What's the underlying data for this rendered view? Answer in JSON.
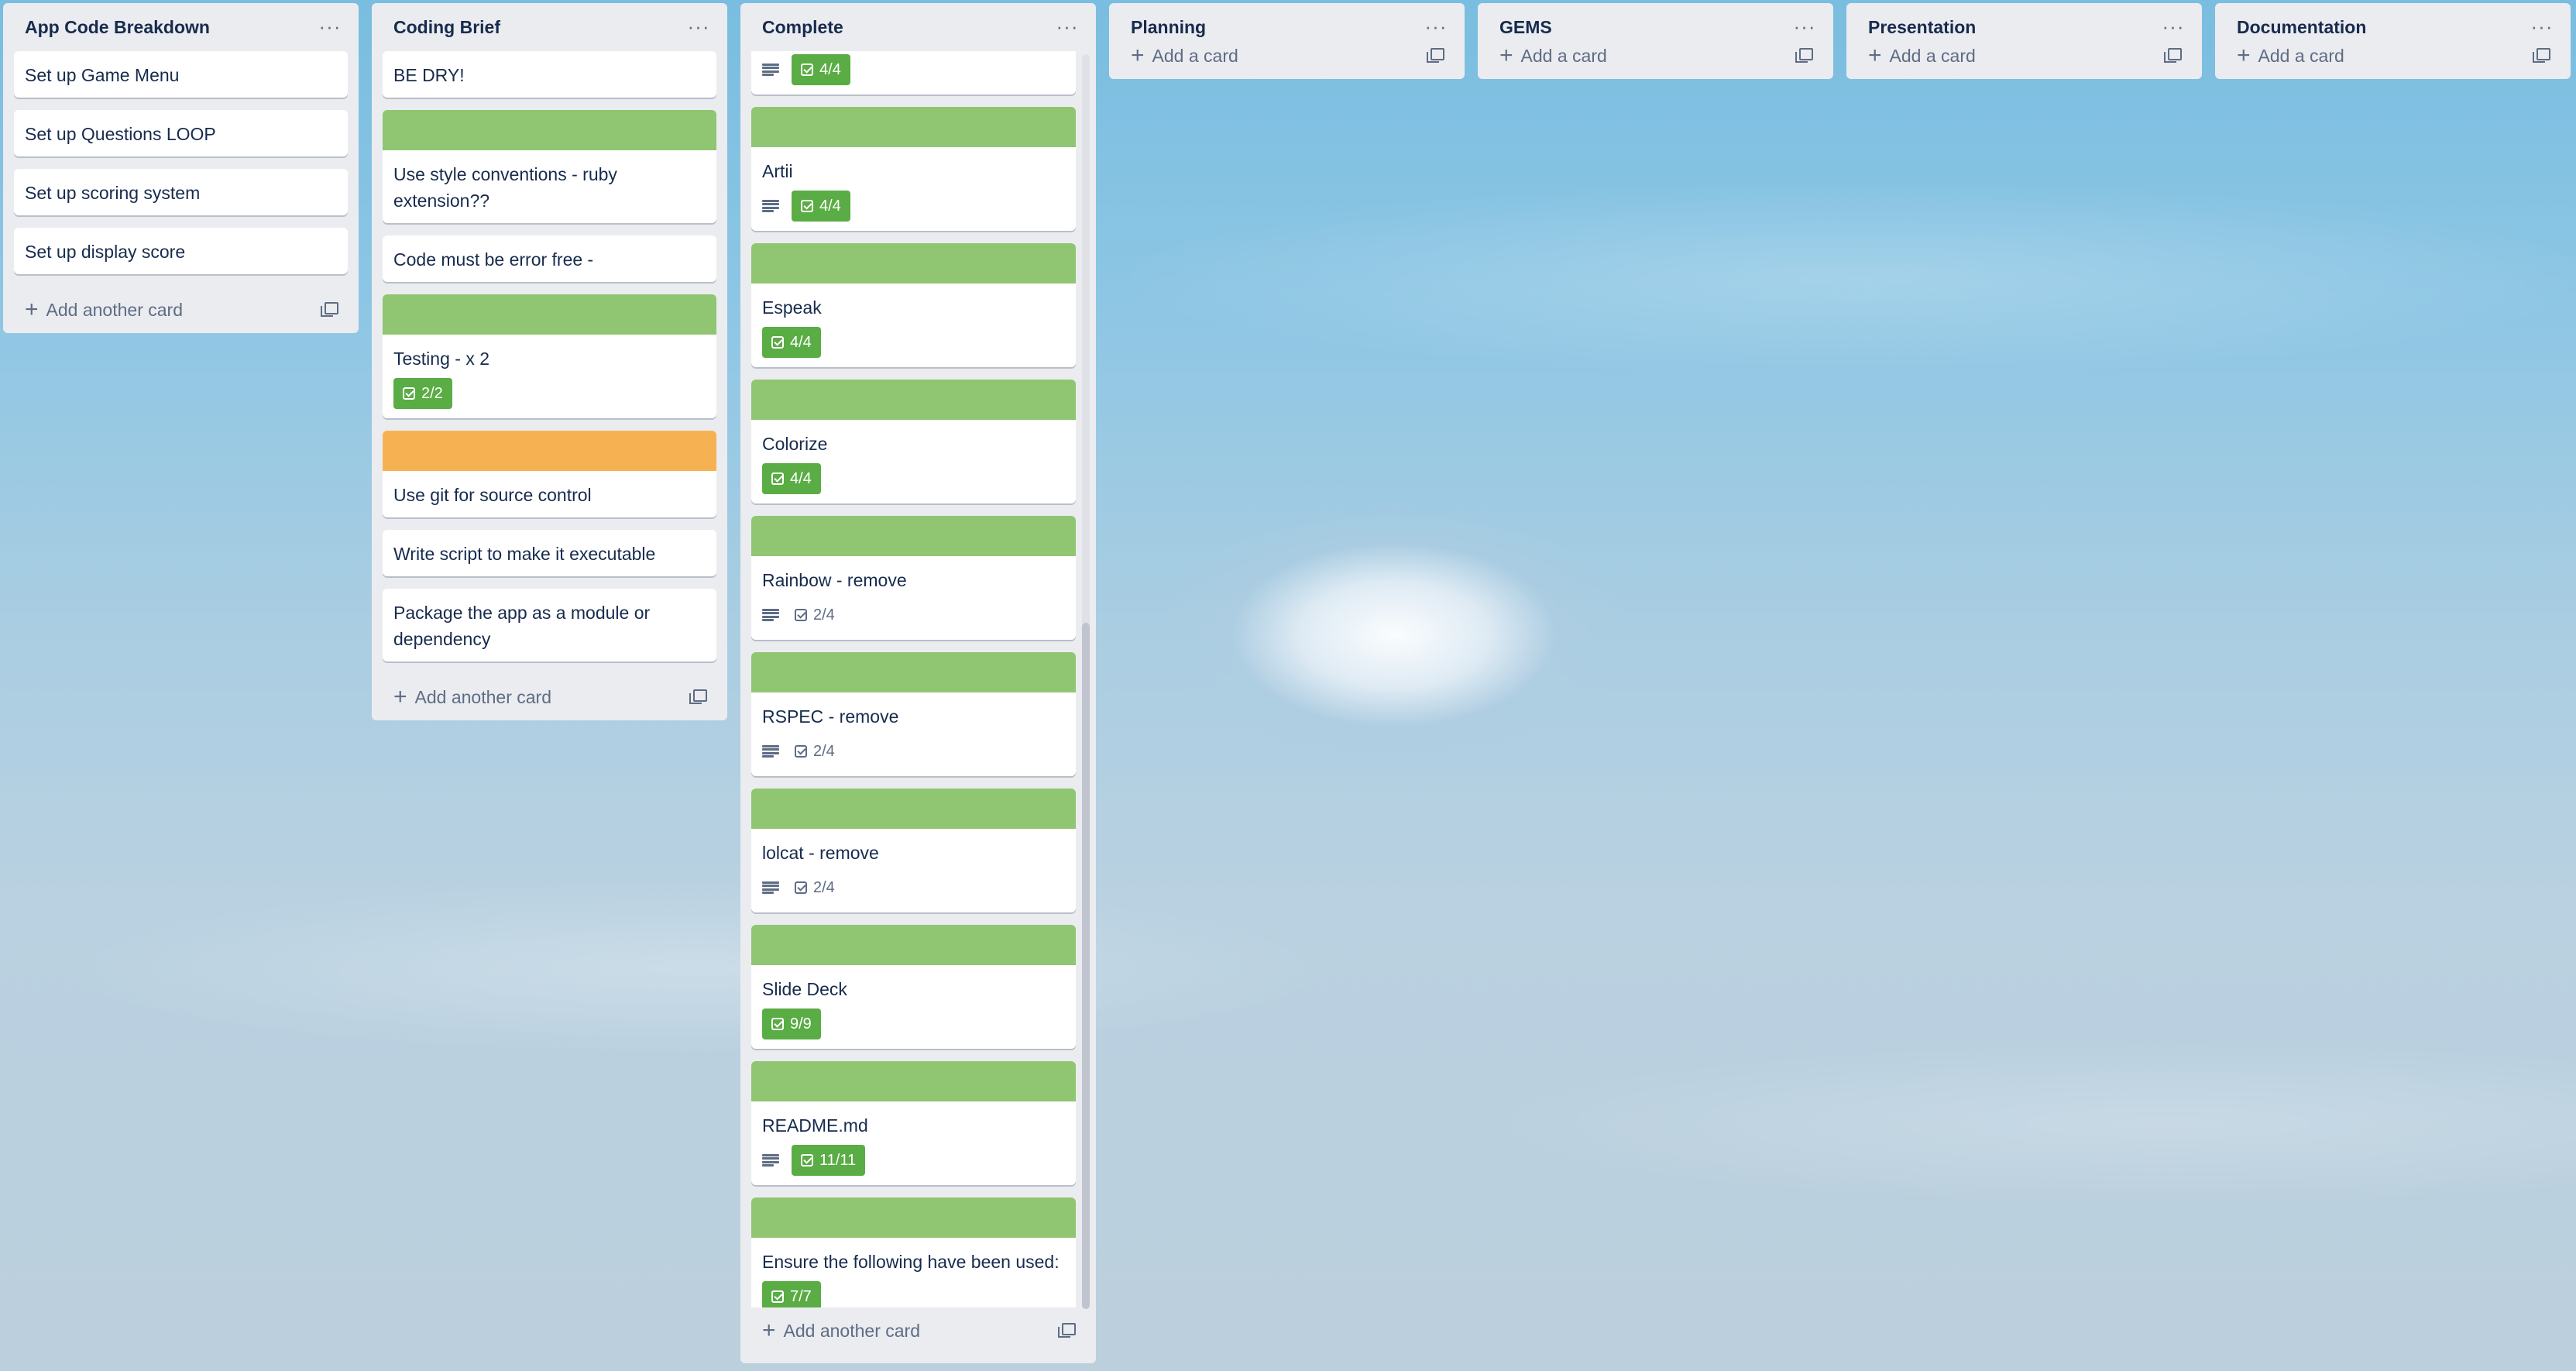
{
  "lists": [
    {
      "title": "App Code Breakdown",
      "cards": [
        {
          "title": "Set up Game Menu"
        },
        {
          "title": "Set up Questions LOOP"
        },
        {
          "title": "Set up scoring system"
        },
        {
          "title": "Set up display score"
        }
      ],
      "add_label": "Add another card"
    },
    {
      "title": "Coding Brief",
      "cards": [
        {
          "title": "BE DRY!"
        },
        {
          "title": "Use style conventions - ruby extension??",
          "label_color": "green"
        },
        {
          "title": "Code must be error free -"
        },
        {
          "title": "Testing - x 2",
          "label_color": "green",
          "checklist": "2/2"
        },
        {
          "title": "Use git for source control",
          "label_color": "orange"
        },
        {
          "title": "Write script to make it executable"
        },
        {
          "title": "Package the app as a module or dependency"
        }
      ],
      "add_label": "Add another card"
    },
    {
      "title": "Complete",
      "cards": [
        {
          "title": "",
          "checklist": "4/4",
          "has_description": true
        },
        {
          "title": "Artii",
          "label_color": "green",
          "checklist": "4/4",
          "has_description": true
        },
        {
          "title": "Espeak",
          "label_color": "green",
          "checklist": "4/4"
        },
        {
          "title": "Colorize",
          "label_color": "green",
          "checklist": "4/4"
        },
        {
          "title": "Rainbow - remove",
          "label_color": "green",
          "checklist": "2/4",
          "has_description": true
        },
        {
          "title": "RSPEC - remove",
          "label_color": "green",
          "checklist": "2/4",
          "has_description": true
        },
        {
          "title": "lolcat - remove",
          "label_color": "green",
          "checklist": "2/4",
          "has_description": true
        },
        {
          "title": "Slide Deck",
          "label_color": "green",
          "checklist": "9/9"
        },
        {
          "title": "README.md",
          "label_color": "green",
          "checklist": "11/11",
          "has_description": true
        },
        {
          "title": "Ensure the following have been used:",
          "label_color": "green",
          "checklist": "7/7"
        }
      ],
      "add_label": "Add another card"
    },
    {
      "title": "Planning",
      "cards": [],
      "add_label": "Add a card"
    },
    {
      "title": "GEMS",
      "cards": [],
      "add_label": "Add a card"
    },
    {
      "title": "Presentation",
      "cards": [],
      "add_label": "Add a card"
    },
    {
      "title": "Documentation",
      "cards": [],
      "add_label": "Add a card"
    }
  ],
  "icons": {
    "list_menu": "ellipsis-icon",
    "add": "plus-icon",
    "template": "card-template-icon",
    "description": "description-icon",
    "checklist": "checklist-icon"
  },
  "colors": {
    "label_green": "#90c572",
    "label_orange": "#f6b252",
    "checklist_complete": "#5aac44",
    "list_background": "#ebecf0"
  }
}
